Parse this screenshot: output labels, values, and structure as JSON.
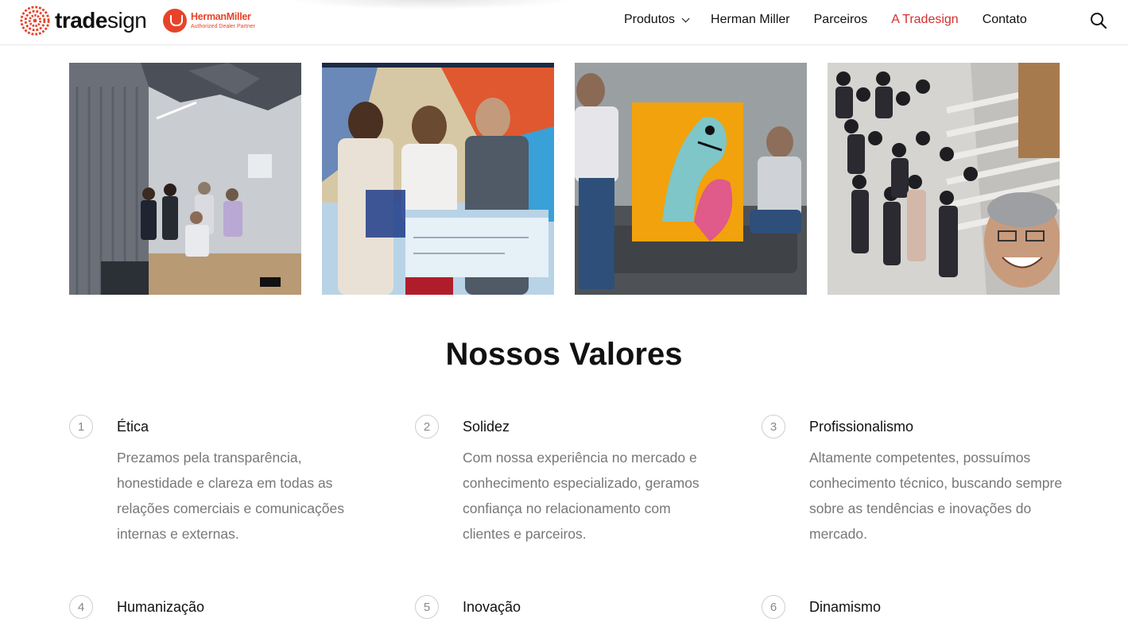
{
  "header": {
    "logo_text_bold": "trade",
    "logo_text_light": "sign",
    "partner_name": "HermanMiller",
    "partner_sub": "Authorized Dealer Partner",
    "nav": [
      {
        "label": "Produtos"
      },
      {
        "label": "Herman Miller"
      },
      {
        "label": "Parceiros"
      },
      {
        "label": "A Tradesign"
      },
      {
        "label": "Contato"
      }
    ],
    "active_index": 3
  },
  "photos": [
    {
      "label": "team-meeting-room-photo"
    },
    {
      "label": "award-ceremony-photo"
    },
    {
      "label": "artwork-sofa-photo"
    },
    {
      "label": "team-selfie-stairs-photo"
    }
  ],
  "section": {
    "title": "Nossos Valores"
  },
  "values": [
    {
      "num": "1",
      "title": "Ética",
      "desc": "Prezamos pela transparência, honestidade e clareza em todas as relações comerciais e comunicações internas e externas."
    },
    {
      "num": "2",
      "title": "Solidez",
      "desc": "Com nossa experiência no mercado e conhecimento especializado, geramos confiança no relacionamento com clientes e parceiros."
    },
    {
      "num": "3",
      "title": "Profissionalismo",
      "desc": "Altamente competentes, possuímos conhecimento técnico, buscando sempre sobre as tendências e inovações do mercado."
    },
    {
      "num": "4",
      "title": "Humanização",
      "desc": ""
    },
    {
      "num": "5",
      "title": "Inovação",
      "desc": ""
    },
    {
      "num": "6",
      "title": "Dinamismo",
      "desc": ""
    }
  ],
  "colors": {
    "brand_red": "#e8432a",
    "active_nav": "#d32f2f",
    "text_muted": "#777777"
  },
  "icons": {
    "logo": "tradesign-spiral-icon",
    "partner": "herman-miller-logo-icon",
    "dropdown": "chevron-down-icon",
    "search": "search-icon"
  }
}
